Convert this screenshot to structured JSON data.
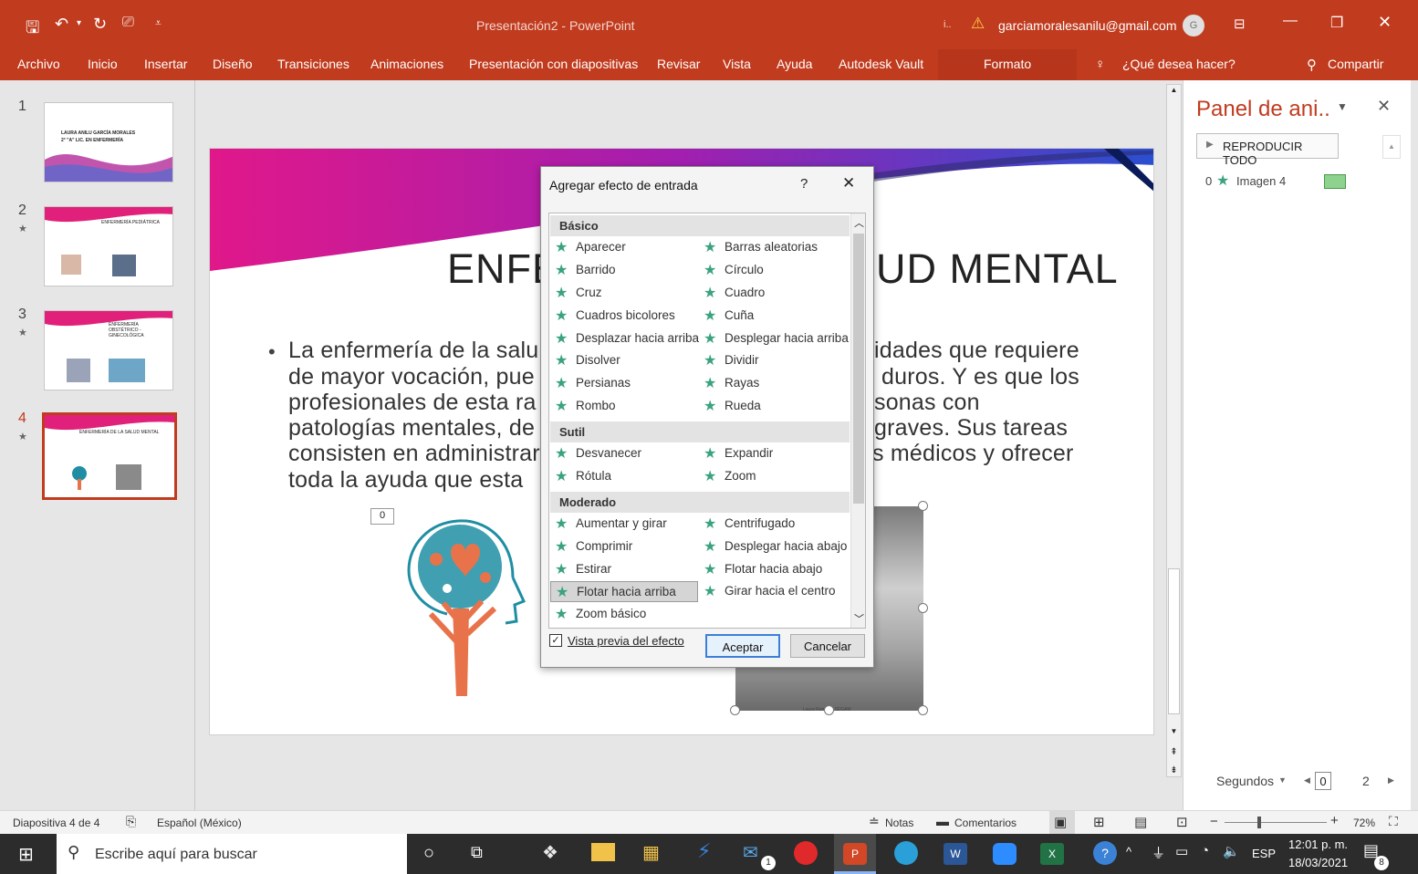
{
  "window": {
    "title": "Presentación2 - PowerPoint",
    "warning_badge": "i..",
    "account_email": "garciamoralesanilu@gmail.com",
    "avatar_initial": "G"
  },
  "ribbon": {
    "tabs": [
      "Archivo",
      "Inicio",
      "Insertar",
      "Diseño",
      "Transiciones",
      "Animaciones",
      "Presentación con diapositivas",
      "Revisar",
      "Vista",
      "Ayuda",
      "Autodesk Vault"
    ],
    "context_tab": "Formato",
    "tell_me": "¿Qué desea hacer?",
    "share": "Compartir"
  },
  "thumbnails": [
    {
      "number": "1",
      "title": "LAURA ANILU GARCÍA MORALES",
      "subtitle": "2° \"A\" LIC. EN ENFERMERÍA",
      "has_star": false
    },
    {
      "number": "2",
      "title": "ENFERMERÍA PEDIÁTRICA",
      "has_star": true
    },
    {
      "number": "3",
      "title": "ENFERMERÍA OBSTÉTRICO - GINECOLÓGICA",
      "has_star": true
    },
    {
      "number": "4",
      "title": "ENFERMERÍA DE LA SALUD MENTAL",
      "has_star": true,
      "selected": true
    }
  ],
  "slide": {
    "title_left": "ENFE",
    "title_right": "UD MENTAL",
    "bullet": "•",
    "body_left": [
      "La enfermería de la salu",
      "de mayor vocación, pue",
      "profesionales de esta ra",
      "patologías mentales, de",
      "consisten en administrar",
      "toda la ayuda que esta"
    ],
    "body_right": [
      "idades que requiere",
      "duros. Y es que los",
      "sonas con",
      "graves. Sus tareas",
      "s médicos y ofrecer"
    ],
    "anim_tag": "0",
    "photo_caption": "Laura Ramos · SEGAM"
  },
  "dialog": {
    "title": "Agregar efecto de entrada",
    "help": "?",
    "groups": [
      {
        "name": "Básico",
        "items": [
          "Aparecer",
          "Barras aleatorias",
          "Barrido",
          "Círculo",
          "Cruz",
          "Cuadro",
          "Cuadros bicolores",
          "Cuña",
          "Desplazar hacia arriba",
          "Desplegar hacia arriba",
          "Disolver",
          "Dividir",
          "Persianas",
          "Rayas",
          "Rombo",
          "Rueda"
        ]
      },
      {
        "name": "Sutil",
        "items": [
          "Desvanecer",
          "Expandir",
          "Rótula",
          "Zoom"
        ]
      },
      {
        "name": "Moderado",
        "items": [
          "Aumentar y girar",
          "Centrifugado",
          "Comprimir",
          "Desplegar hacia abajo",
          "Estirar",
          "Flotar hacia abajo",
          "Flotar hacia arriba",
          "Girar hacia el centro",
          "Zoom básico"
        ]
      }
    ],
    "selected_effect": "Flotar hacia arriba",
    "preview_label": "Vista previa del efecto",
    "preview_checked": true,
    "ok": "Aceptar",
    "cancel": "Cancelar"
  },
  "animation_pane": {
    "title": "Panel de ani..",
    "play_all": "REPRODUCIR TODO",
    "items": [
      {
        "index": "0",
        "name": "Imagen 4"
      }
    ],
    "seconds_label": "Segundos",
    "timeline_start": "0",
    "timeline_end": "2"
  },
  "status": {
    "slide_info": "Diapositiva 4 de 4",
    "language": "Español (México)",
    "notes": "Notas",
    "comments": "Comentarios",
    "zoom": "72%"
  },
  "taskbar": {
    "search_placeholder": "Escribe aquí para buscar",
    "lang": "ESP",
    "time": "12:01 p. m.",
    "date": "18/03/2021",
    "notifications": "8",
    "mail_badge": "1"
  },
  "colors": {
    "accent": "#c13b1e",
    "effect_star": "#3aa37e",
    "tree_orange": "#e8734a",
    "tree_teal": "#1f8ea3"
  }
}
